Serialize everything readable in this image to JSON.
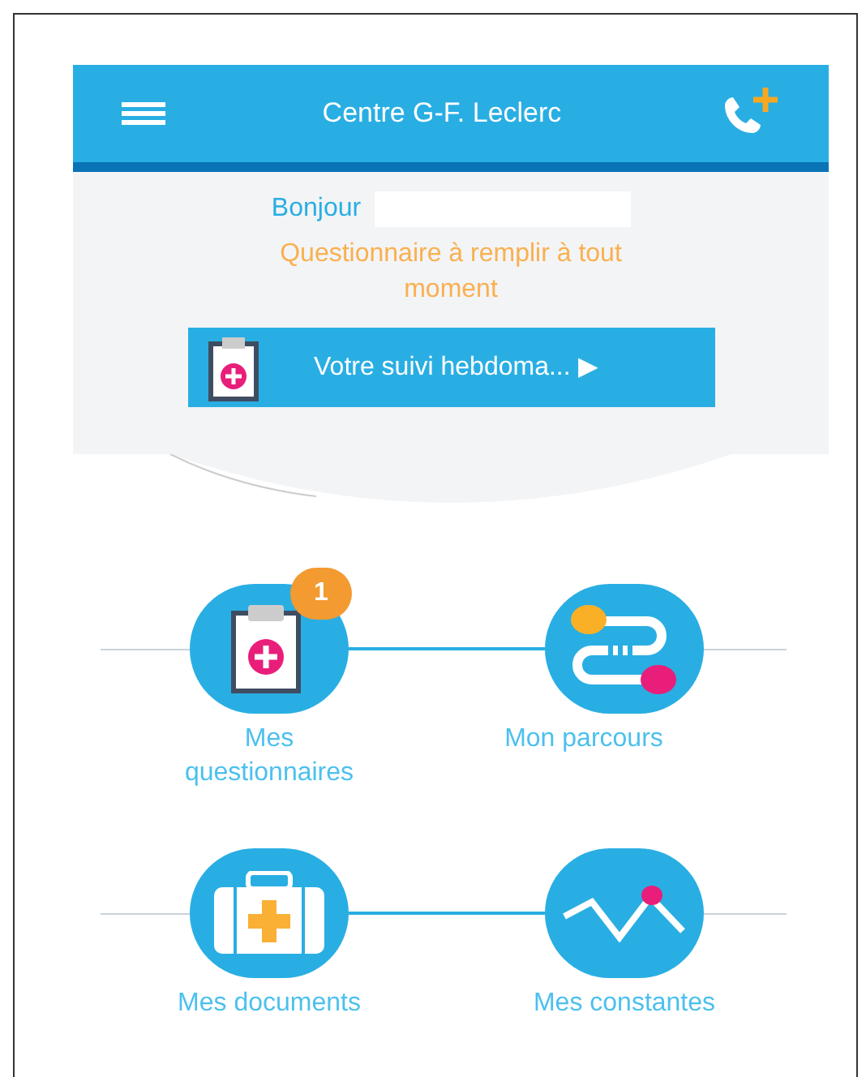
{
  "header": {
    "title": "Centre G-F. Leclerc"
  },
  "greeting": {
    "label": "Bonjour"
  },
  "notice": "Questionnaire à remplir à tout moment",
  "weekly_button": {
    "label": "Votre suivi hebdoma... ▶"
  },
  "tiles": [
    {
      "kind": "questionnaires",
      "label": "Mes questionnaires",
      "badge": "1"
    },
    {
      "kind": "parcours",
      "label": "Mon parcours"
    },
    {
      "kind": "documents",
      "label": "Mes documents"
    },
    {
      "kind": "constantes",
      "label": "Mes constantes"
    }
  ]
}
